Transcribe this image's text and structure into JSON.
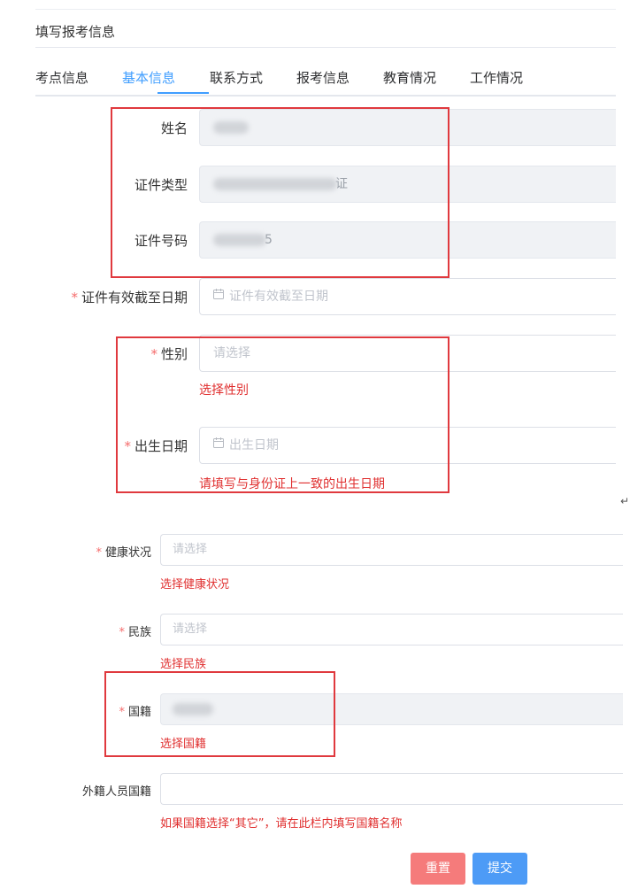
{
  "page": {
    "title": "填写报考信息"
  },
  "tabs": [
    "考点信息",
    "基本信息",
    "联系方式",
    "报考信息",
    "教育情况",
    "工作情况"
  ],
  "form": {
    "name_label": "姓名",
    "id_type_label": "证件类型",
    "id_type_tail": "证",
    "id_number_label": "证件号码",
    "id_number_tail": "5",
    "expiry_label": "证件有效截至日期",
    "expiry_placeholder": "证件有效截至日期",
    "gender_label": "性别",
    "gender_placeholder": "请选择",
    "gender_error": "选择性别",
    "birth_label": "出生日期",
    "birth_placeholder": "出生日期",
    "birth_error": "请填写与身份证上一致的出生日期",
    "health_label": "健康状况",
    "health_placeholder": "请选择",
    "health_error": "选择健康状况",
    "ethnicity_label": "民族",
    "ethnicity_placeholder": "请选择",
    "ethnicity_error": "选择民族",
    "nationality_label": "国籍",
    "nationality_error": "选择国籍",
    "foreign_nationality_label": "外籍人员国籍",
    "foreign_nationality_hint": "如果国籍选择“其它”，请在此栏内填写国籍名称"
  },
  "buttons": {
    "reset": "重置",
    "submit": "提交"
  },
  "required_mark": "*",
  "return_mark": "↵",
  "icons": {
    "calendar": "calendar-icon"
  },
  "colors": {
    "accent": "#409eff",
    "error": "#e03030",
    "reset_button": "#f57b7b",
    "submit_button": "#4d9bf6"
  }
}
